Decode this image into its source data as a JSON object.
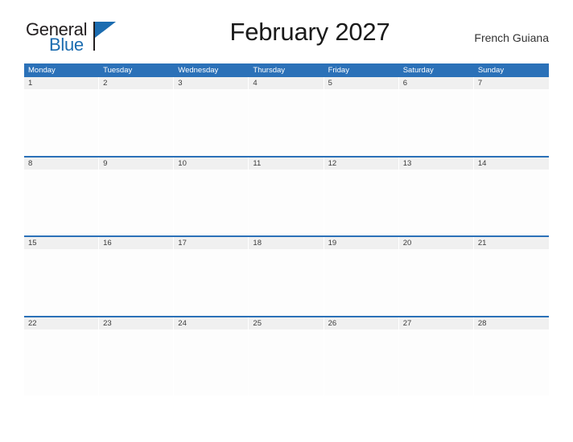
{
  "brand": {
    "name_part1": "General",
    "name_part2": "Blue",
    "color_dark": "#231f20",
    "color_blue": "#1b6cb0"
  },
  "header": {
    "title": "February 2027",
    "location": "French Guiana"
  },
  "theme": {
    "header_bar": "#2b71b8",
    "date_band": "#f0f0f0",
    "row_divider": "#2b71b8",
    "page_background": "#ffffff"
  },
  "calendar": {
    "month": "February",
    "year": "2027",
    "week_start": "Monday",
    "weekdays": [
      "Monday",
      "Tuesday",
      "Wednesday",
      "Thursday",
      "Friday",
      "Saturday",
      "Sunday"
    ],
    "weeks": [
      {
        "days": [
          "1",
          "2",
          "3",
          "4",
          "5",
          "6",
          "7"
        ]
      },
      {
        "days": [
          "8",
          "9",
          "10",
          "11",
          "12",
          "13",
          "14"
        ]
      },
      {
        "days": [
          "15",
          "16",
          "17",
          "18",
          "19",
          "20",
          "21"
        ]
      },
      {
        "days": [
          "22",
          "23",
          "24",
          "25",
          "26",
          "27",
          "28"
        ]
      }
    ]
  }
}
